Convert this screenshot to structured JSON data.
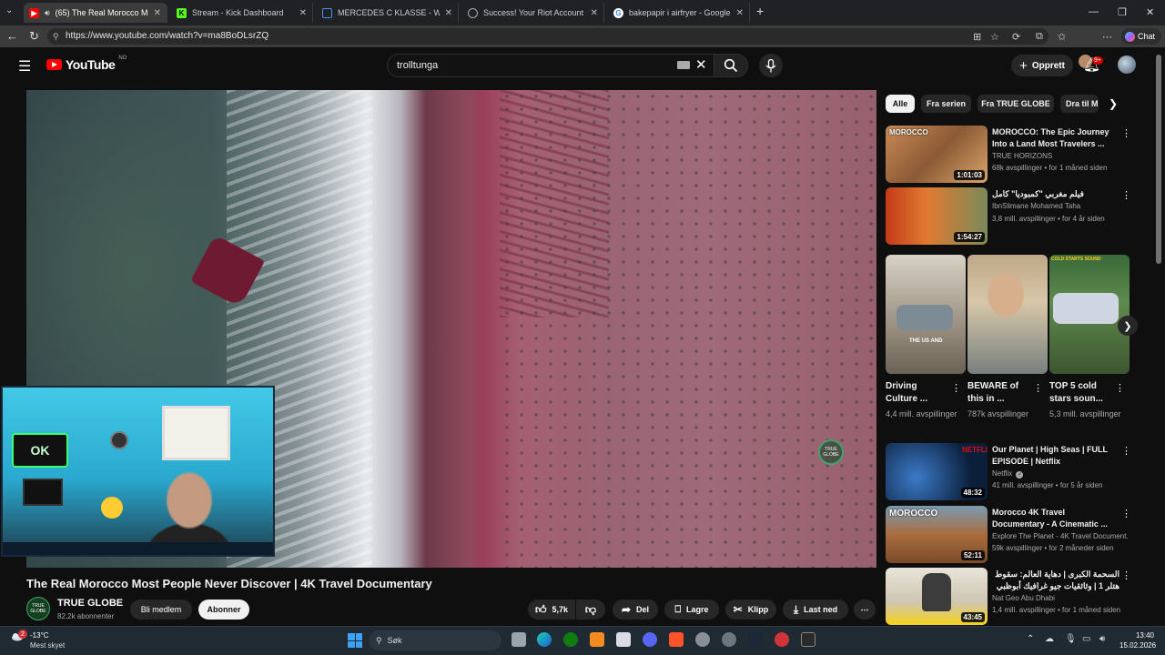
{
  "browser": {
    "tabs": [
      {
        "title": "(65) The Real Morocco Most P",
        "favicon": "youtube",
        "color": "#ff0000"
      },
      {
        "title": "Stream - Kick Dashboard",
        "favicon": "kick",
        "color": "#53fc18"
      },
      {
        "title": "MERCEDES C KLASSE - W204 - AM",
        "favicon": "bookmark",
        "color": "#4a90e2"
      },
      {
        "title": "Success! Your Riot Account is now",
        "favicon": "globe",
        "color": "#aaaaaa"
      },
      {
        "title": "bakepapir i airfryer - Google Search",
        "favicon": "google",
        "color": "#4285f4"
      }
    ],
    "new_tab_label": "+",
    "url": "https://www.youtube.com/watch?v=ma8BoDLsrZQ",
    "copilot_label": "Chat"
  },
  "youtube": {
    "logo_text": "YouTube",
    "country_code": "NO",
    "search_value": "trolltunga",
    "create_label": "Opprett",
    "notification_count": "9+"
  },
  "video": {
    "title": "The Real Morocco Most People Never Discover | 4K Travel Documentary",
    "watermark": "TRUE GLOBE",
    "webcam_sign": "OK",
    "channel": {
      "name": "TRUE GLOBE",
      "subscribers": "82,2k abonnenter",
      "avatar_text": "TRUE GLOBE"
    },
    "join_label": "Bli medlem",
    "subscribe_label": "Abonner",
    "actions": {
      "likes": "5,7k",
      "share": "Del",
      "save": "Lagre",
      "clip": "Klipp",
      "download": "Last ned"
    }
  },
  "sidebar": {
    "chips": [
      "Alle",
      "Fra serien",
      "Fra TRUE GLOBE",
      "Dra til M"
    ],
    "recommendations_top": [
      {
        "title": "MOROCCO: The Epic Journey Into a Land Most Travelers ...",
        "channel": "TRUE HORIZONS",
        "meta": "68k avspillinger • for 1 måned siden",
        "duration": "1:01:03",
        "thumb_label": "MOROCCO"
      },
      {
        "title": "فيلم مغربي \"كمبوديا\" كامل",
        "channel": "IbnSlimane Mohamed Taha",
        "meta": "3,8 mill. avspillinger • for 4 år siden",
        "duration": "1:54:27",
        "thumb_label": ""
      }
    ],
    "shorts": [
      {
        "title": "Driving Culture ...",
        "views": "4,4 mill. avspillinger",
        "thumb_label": "THE US AND"
      },
      {
        "title": "BEWARE of this in ...",
        "views": "787k avspillinger",
        "thumb_label": ""
      },
      {
        "title": "TOP 5 cold stars soun...",
        "views": "5,3 mill. avspillinger",
        "thumb_label": "COLD STARTS SOUND"
      }
    ],
    "recommendations_bottom": [
      {
        "title": "Our Planet | High Seas | FULL EPISODE | Netflix",
        "channel": "Netflix",
        "verified": true,
        "meta": "41 mill. avspillinger • for 5 år siden",
        "duration": "48:32",
        "thumb_label": "NETFLIX"
      },
      {
        "title": "Morocco 4K Travel Documentary - A Cinematic ...",
        "channel": "Explore The Planet - 4K Travel Document...",
        "meta": "59k avspillinger • for 2 måneder siden",
        "duration": "52:11",
        "thumb_label": "MOROCCO"
      },
      {
        "title": "السحمة الكبرى | دهاية العالم: سقوط هتلر 1 | وثائقيات جيو غرافيك أبوظبي",
        "channel": "Nat Geo Abu Dhabi",
        "meta": "1,4 mill. avspillinger • for 1 måned siden",
        "duration": "43:45",
        "thumb_label": ""
      }
    ]
  },
  "taskbar": {
    "weather_temp": "-13°C",
    "weather_cond": "Mest skyet",
    "weather_badge": "2",
    "search_label": "Søk",
    "time": "13:40",
    "date": "15.02.2026"
  }
}
